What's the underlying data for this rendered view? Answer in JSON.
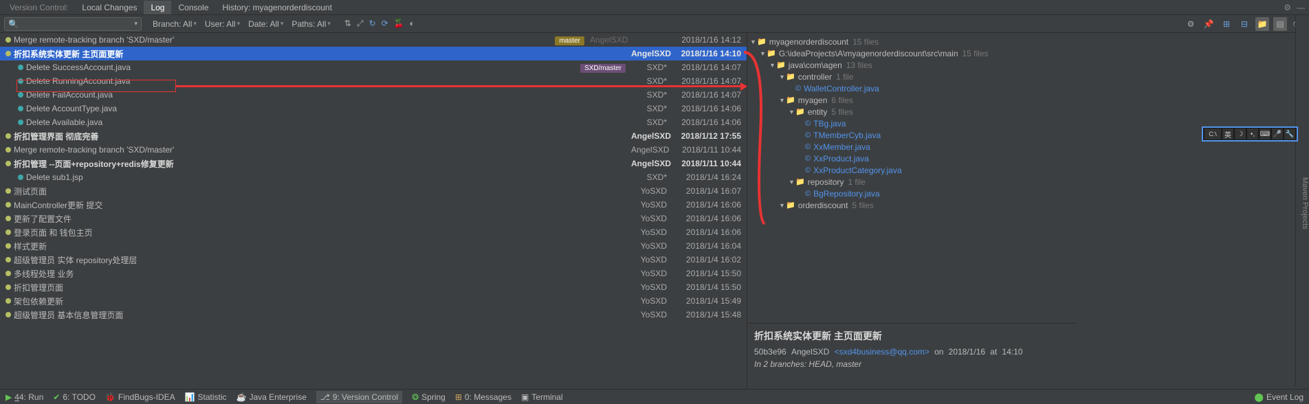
{
  "top_tabs": {
    "version_control": "Version Control:",
    "local_changes": "Local Changes",
    "log": "Log",
    "console": "Console",
    "history": "History: myagenorderdiscount"
  },
  "toolbar": {
    "search_placeholder": "",
    "filters": {
      "branch": "Branch: All",
      "user": "User: All",
      "date": "Date: All",
      "paths": "Paths: All"
    }
  },
  "commits": [
    {
      "msg": "Merge remote-tracking branch 'SXD/master'",
      "author": "",
      "date": "2018/1/16 14:12",
      "dim": true,
      "tags": [
        {
          "label": "master",
          "cls": "tag-yellow"
        }
      ],
      "author2": "AngelSXD"
    },
    {
      "msg": "折扣系统实体更新 主页面更新",
      "author": "AngelSXD",
      "date": "2018/1/16 14:10",
      "selected": true,
      "bold": true
    },
    {
      "msg": "Delete SuccessAccount.java",
      "author": "SXD*",
      "date": "2018/1/16 14:07",
      "tags": [
        {
          "label": "SXD/master",
          "cls": "tag-purple"
        }
      ]
    },
    {
      "msg": "Delete RunningAccount.java",
      "author": "SXD*",
      "date": "2018/1/16 14:07"
    },
    {
      "msg": "Delete FailAccount.java",
      "author": "SXD*",
      "date": "2018/1/16 14:07"
    },
    {
      "msg": "Delete AccountType.java",
      "author": "SXD*",
      "date": "2018/1/16 14:06"
    },
    {
      "msg": "Delete Available.java",
      "author": "SXD*",
      "date": "2018/1/16 14:06"
    },
    {
      "msg": "折扣管理界面 彻底完善",
      "author": "AngelSXD",
      "date": "2018/1/12 17:55",
      "bold": true
    },
    {
      "msg": "Merge remote-tracking branch 'SXD/master'",
      "author": "AngelSXD",
      "date": "2018/1/11 10:44",
      "dim": true
    },
    {
      "msg": "折扣管理 --页面+repository+redis修复更新",
      "author": "AngelSXD",
      "date": "2018/1/11 10:44",
      "bold": true
    },
    {
      "msg": "Delete sub1.jsp",
      "author": "SXD*",
      "date": "2018/1/4 16:24"
    },
    {
      "msg": "测试页面",
      "author": "YoSXD",
      "date": "2018/1/4 16:07"
    },
    {
      "msg": "MainController更新 提交",
      "author": "YoSXD",
      "date": "2018/1/4 16:06"
    },
    {
      "msg": "更新了配置文件",
      "author": "YoSXD",
      "date": "2018/1/4 16:06"
    },
    {
      "msg": "登录页面 和 钱包主页",
      "author": "YoSXD",
      "date": "2018/1/4 16:06"
    },
    {
      "msg": "样式更新",
      "author": "YoSXD",
      "date": "2018/1/4 16:04"
    },
    {
      "msg": "超级管理员 实体 repository处理层",
      "author": "YoSXD",
      "date": "2018/1/4 16:02"
    },
    {
      "msg": "多线程处理 业务",
      "author": "YoSXD",
      "date": "2018/1/4 15:50"
    },
    {
      "msg": "折扣管理页面",
      "author": "YoSXD",
      "date": "2018/1/4 15:50"
    },
    {
      "msg": "架包依赖更新",
      "author": "YoSXD",
      "date": "2018/1/4 15:49"
    },
    {
      "msg": "超级管理员 基本信息管理页面",
      "author": "YoSXD",
      "date": "2018/1/4 15:48"
    }
  ],
  "tree": [
    {
      "ind": 0,
      "type": "folder",
      "name": "myagenorderdiscount",
      "count": "15 files",
      "chev": "▼"
    },
    {
      "ind": 1,
      "type": "folder",
      "name": "G:\\ideaProjects\\A\\myagenorderdiscount\\src\\main",
      "count": "15 files",
      "chev": "▼"
    },
    {
      "ind": 2,
      "type": "folder",
      "name": "java\\com\\agen",
      "count": "13 files",
      "chev": "▼"
    },
    {
      "ind": 3,
      "type": "folder",
      "name": "controller",
      "count": "1 file",
      "chev": "▼"
    },
    {
      "ind": 4,
      "type": "java",
      "name": "WalletController.java"
    },
    {
      "ind": 3,
      "type": "folder",
      "name": "myagen",
      "count": "6 files",
      "chev": "▼"
    },
    {
      "ind": 4,
      "type": "folder",
      "name": "entity",
      "count": "5 files",
      "chev": "▼"
    },
    {
      "ind": 5,
      "type": "java",
      "name": "TBg.java"
    },
    {
      "ind": 5,
      "type": "java",
      "name": "TMemberCyb.java"
    },
    {
      "ind": 5,
      "type": "java",
      "name": "XxMember.java"
    },
    {
      "ind": 5,
      "type": "java",
      "name": "XxProduct.java"
    },
    {
      "ind": 5,
      "type": "java",
      "name": "XxProductCategory.java"
    },
    {
      "ind": 4,
      "type": "folder",
      "name": "repository",
      "count": "1 file",
      "chev": "▼"
    },
    {
      "ind": 5,
      "type": "java",
      "name": "BgRepository.java"
    },
    {
      "ind": 3,
      "type": "folder",
      "name": "orderdiscount",
      "count": "5 files",
      "chev": "▼"
    }
  ],
  "detail": {
    "title": "折扣系统实体更新 主页面更新",
    "hash": "50b3e96",
    "author": "AngelSXD",
    "email": "<sxd4business@qq.com>",
    "on": "on",
    "date": "2018/1/16",
    "at": "at",
    "time": "14:10",
    "branches_label": "In 2 branches:",
    "branches": "HEAD, master"
  },
  "status_bar": {
    "run": "4: Run",
    "todo": "6: TODO",
    "findbugs": "FindBugs-IDEA",
    "statistic": "Statistic",
    "java_ee": "Java Enterprise",
    "vc": "9: Version Control",
    "spring": "Spring",
    "messages": "0: Messages",
    "terminal": "Terminal",
    "event_log": "Event Log"
  },
  "right_sidebar": "Maven Projects"
}
